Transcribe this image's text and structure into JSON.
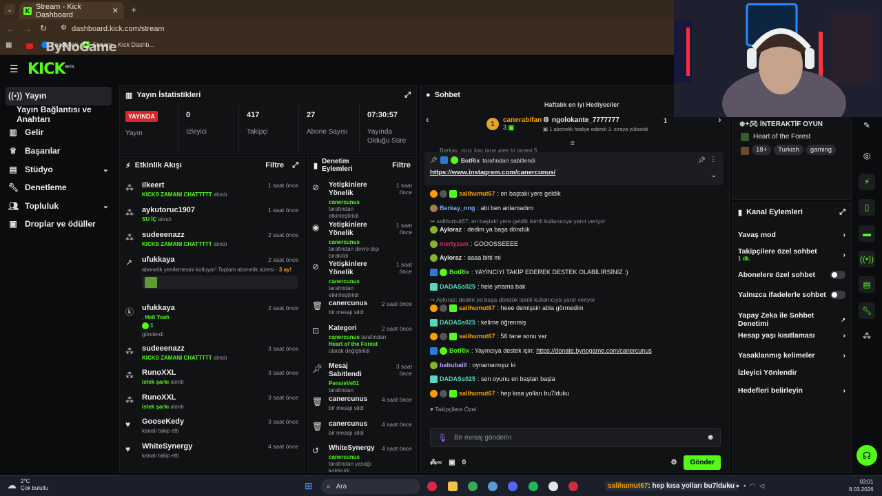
{
  "browser": {
    "tab_title": "Stream - Kick Dashboard",
    "new_tab": "+",
    "url": "dashboard.kick.com/stream",
    "bookmarks": [
      "Facebook",
      "Stream - Kick Dashb..."
    ],
    "overlay_brand": "ByNoGame"
  },
  "app": {
    "logo": "KICK",
    "logo_tag": "BETA"
  },
  "sidebar": {
    "items": [
      {
        "label": "Yayın",
        "icon": "broadcast-icon"
      },
      {
        "label": "Yayın Bağlantısı ve Anahtarı"
      },
      {
        "label": "Gelir",
        "icon": "revenue-icon"
      },
      {
        "label": "Başarılar",
        "icon": "trophy-icon"
      },
      {
        "label": "Stüdyo",
        "icon": "studio-icon"
      },
      {
        "label": "Denetleme",
        "icon": "wrench-icon"
      },
      {
        "label": "Topluluk",
        "icon": "community-icon"
      },
      {
        "label": "Droplar ve ödüller",
        "icon": "drops-icon"
      }
    ]
  },
  "stats": {
    "title": "Yayın İstatistikleri",
    "live_badge": "YAYINDA",
    "live_label": "Yayın",
    "items": [
      {
        "value": "0",
        "label": "İzleyici"
      },
      {
        "value": "417",
        "label": "Takipçi"
      },
      {
        "value": "27",
        "label": "Abone Sayısı"
      },
      {
        "value": "07:30:57",
        "label": "Yayında Olduğu Süre"
      }
    ]
  },
  "activity": {
    "title": "Etkinlik Akışı",
    "filter": "Filtre",
    "items": [
      {
        "name": "ilkeert",
        "detail_green": "KICKS ZAMANI CHATTTTT",
        "detail": "alındı",
        "time": "1 saat önce"
      },
      {
        "name": "aykutoruc1907",
        "detail_green": "SU İÇ",
        "detail": "alındı",
        "time": "1 saat önce"
      },
      {
        "name": "sudeeenazz",
        "detail_green": "KICKS ZAMANI CHATTTTT",
        "detail": "alındı",
        "time": "2 saat önce"
      },
      {
        "name": "ufukkaya",
        "detail": "abonelik yenilemesini kutluyor! Toplam abonelik süresi -",
        "detail_orange": "3 ay!",
        "time": "2 saat önce"
      },
      {
        "name": "ufukkaya",
        "detail": ",",
        "detail_green": "Hell Yeah",
        "count": "1",
        "sent": "gönderdi",
        "time": "2 saat önce"
      },
      {
        "name": "sudeeenazz",
        "detail_green": "KICKS ZAMANI CHATTTTT",
        "detail": "alındı",
        "time": "3 saat önce"
      },
      {
        "name": "RunoXXL",
        "detail_green": "istek şarkı",
        "detail": "alındı",
        "time": "3 saat önce"
      },
      {
        "name": "RunoXXL",
        "detail_green": "istek şarkı",
        "detail": "alındı",
        "time": "3 saat önce"
      },
      {
        "name": "GooseKedy",
        "detail": "kanalı takip etti",
        "time": "3 saat önce"
      },
      {
        "name": "WhiteSynergy",
        "detail": "kanalı takip etti",
        "time": "4 saat önce"
      }
    ]
  },
  "moderation": {
    "title": "Denetim Eylemleri",
    "filter": "Filtre",
    "items": [
      {
        "name": "Yetişkinlere Yönelik",
        "user": "canercunus",
        "detail": "tarafından etkinleştirildi",
        "time": "1 saat önce"
      },
      {
        "name": "Yetişkinlere Yönelik",
        "user": "canercunus",
        "detail": "tarafından devre dışı bırakıldı",
        "time": "1 saat önce"
      },
      {
        "name": "Yetişkinlere Yönelik",
        "user": "canercunus",
        "detail": "tarafından etkinleştirildi",
        "time": "1 saat önce"
      },
      {
        "name": "canercunus",
        "detail": "bir mesajı sildi",
        "time": "2 saat önce"
      },
      {
        "name": "Kategori",
        "user": "canercunus",
        "detail": "tarafından",
        "highlight": "Heart of the Forest",
        "detail2": "olarak değiştirildi",
        "time": "2 saat önce"
      },
      {
        "name": "Mesaj Sabitlendi",
        "user": "PensieVe51",
        "detail": "tarafından",
        "time": "3 saat önce"
      },
      {
        "name": "canercunus",
        "detail": "bir mesajı sildi",
        "time": "4 saat önce"
      },
      {
        "name": "canercunus",
        "detail": "bir mesajı sildi",
        "time": "4 saat önce"
      },
      {
        "name": "WhiteSynergy",
        "user": "canercunus",
        "detail": "tarafından yasağı kaldırıldı",
        "time": "4 saat önce"
      }
    ]
  },
  "chat": {
    "title": "Sohbet",
    "gifters_title": "Haftalık en iyi Hediyeciler",
    "gifter1": {
      "rank": "1",
      "name": "canerabifan",
      "count": "3"
    },
    "gifter2": {
      "name": "ngolokante_7777777",
      "count": "1",
      "note": "1 abonelik hediye ederek 3. sıraya yükseldi"
    },
    "partial_line": "Berkay_nng: kaç tane ateş bi tanesi 5",
    "pinned_by": "BotRix",
    "pinned_suffix": "tarafından sabitlendi",
    "pinned_link": "https://www.instagram.com/canercunus/",
    "messages": [
      {
        "user": "salihumut67",
        "color": "#f59f0a",
        "text": ": en baştaki yere geldik"
      },
      {
        "user": "Berkay_nng",
        "color": "#7aa7ff",
        "text": ": abi ben anlamadım"
      },
      {
        "reply": "salihumut67: en baştaki yere geldik isimli kullanıcıya yanıt veriyor"
      },
      {
        "user": "Ayloraz",
        "color": "#e6e6e6",
        "text": ": dedim ya başa döndük"
      },
      {
        "user": "mertyzam",
        "color": "#e0245e",
        "text": ": GOOOSSEEEE"
      },
      {
        "user": "Ayloraz",
        "color": "#e6e6e6",
        "text": ": aaaa bitti mi"
      },
      {
        "user": "BotRix",
        "color": "#53fc18",
        "text": ": YAYINCIYI TAKİP EDEREK DESTEK OLABİLİRSİNİZ :)"
      },
      {
        "user": "DADASs025",
        "color": "#56d6c1",
        "text": ": hele yrrama bak"
      },
      {
        "reply": "Ayloraz: dedim ya başa döndük isimli kullanıcıya yanıt veriyor"
      },
      {
        "user": "salihumut67",
        "color": "#f59f0a",
        "text": ": heee demişsin abla görmedim"
      },
      {
        "user": "DADASs025",
        "color": "#56d6c1",
        "text": ": kelime öğrenmiş"
      },
      {
        "user": "salihumut67",
        "color": "#f59f0a",
        "text": ": 56 tane sonu var"
      },
      {
        "user": "BotRix",
        "color": "#53fc18",
        "text": ": Yayıncıya destek için: ",
        "link": "https://donate.bynogame.com/canercunus"
      },
      {
        "user": "babuballl",
        "color": "#b9a6ff",
        "text": ": oynamamışız ki"
      },
      {
        "user": "DADASs025",
        "color": "#56d6c1",
        "text": ": sen oyunu en baştan başla"
      },
      {
        "user": "salihumut67",
        "color": "#f59f0a",
        "text": ": hep kısa yolları bu7lduku"
      }
    ],
    "followers_only": "Takipçilere Özel",
    "input_placeholder": "Bir mesaj gönderin",
    "points": "0",
    "send": "Gönder"
  },
  "stream_info": {
    "title": "İNTERAKTİF OYUN",
    "category": "Heart of the Forest",
    "tags": [
      "18+",
      "Turkish",
      "gaming"
    ]
  },
  "channel_actions": {
    "title": "Kanal Eylemleri",
    "items": [
      {
        "label": "Yavaş mod",
        "control": "chevron"
      },
      {
        "label": "Takipçilere özel sohbet",
        "sub": "1 dk.",
        "control": "chevron"
      },
      {
        "label": "Abonelere özel sohbet",
        "control": "toggle"
      },
      {
        "label": "Yalnızca ifadelerle sohbet",
        "control": "toggle"
      },
      {
        "label": "Yapay Zeka ile Sohbet Denetimi",
        "control": "external"
      },
      {
        "label": "Hesap yaşı kısıtlaması",
        "control": "chevron"
      },
      {
        "label": "Yasaklanmış kelimeler",
        "control": "chevron"
      },
      {
        "label": "İzleyici Yönlendir",
        "control": "none"
      },
      {
        "label": "Hedefleri belirleyin",
        "control": "chevron"
      }
    ]
  },
  "taskbar": {
    "weather_temp": "2°C",
    "weather_text": "Çok bulutlu",
    "search": "Ara",
    "ticker": ": hep kısa yolları bu7lduku",
    "ticker_user": "salihumut67",
    "time": "03:01",
    "date": "8.03.2026"
  },
  "colors": {
    "kick_green": "#53fc18",
    "live_red": "#d9252a",
    "panel": "#111214",
    "background": "#0b0c0e"
  }
}
